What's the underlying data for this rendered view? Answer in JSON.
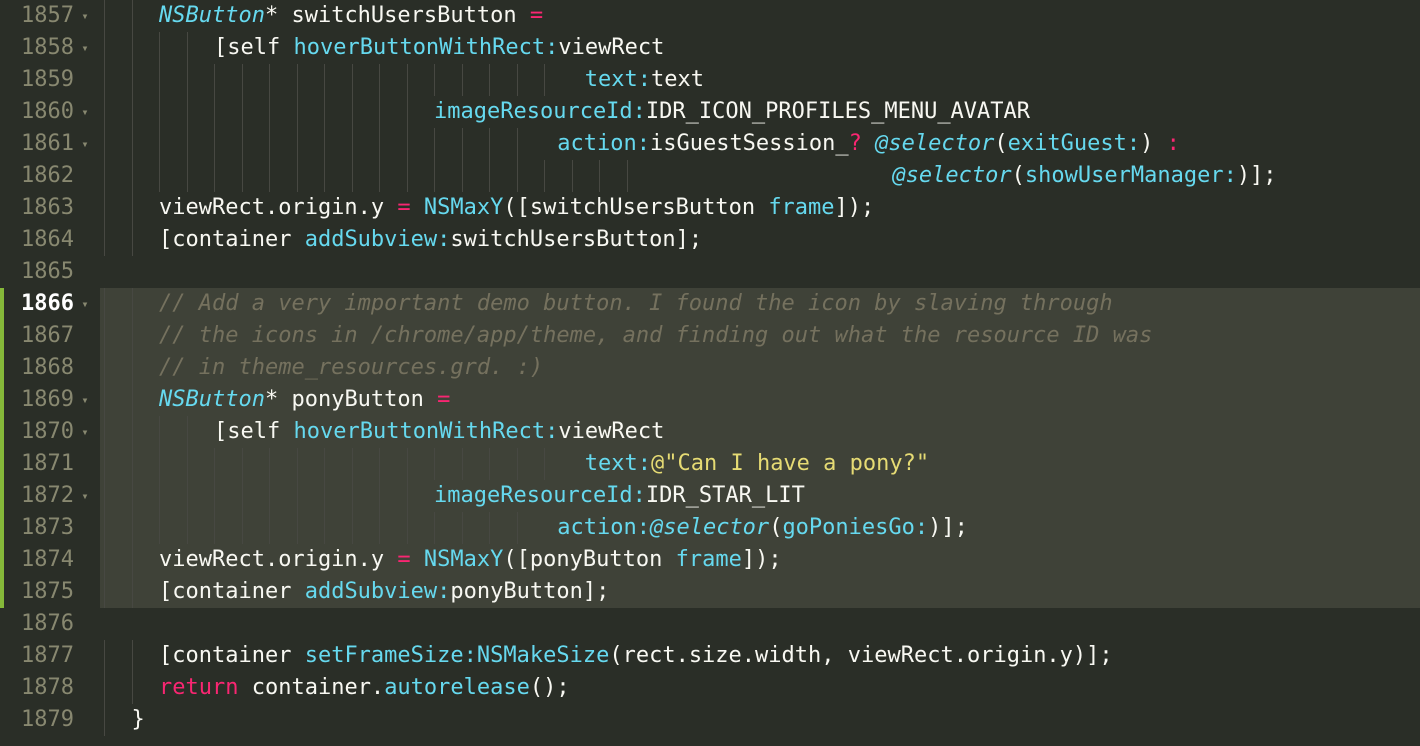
{
  "editor": {
    "visible_lines": [
      {
        "num": "1857",
        "fold": true,
        "marker": "",
        "hl": false,
        "tokens": [
          {
            "t": "    ",
            "c": "tok-default"
          },
          {
            "t": "NSButton",
            "c": "tok-type"
          },
          {
            "t": "* switchUsersButton ",
            "c": "tok-default"
          },
          {
            "t": "=",
            "c": "tok-op"
          }
        ]
      },
      {
        "num": "1858",
        "fold": true,
        "marker": "",
        "hl": false,
        "tokens": [
          {
            "t": "        [",
            "c": "tok-default"
          },
          {
            "t": "self",
            "c": "tok-default"
          },
          {
            "t": " ",
            "c": "tok-default"
          },
          {
            "t": "hoverButtonWithRect:",
            "c": "tok-msg"
          },
          {
            "t": "viewRect",
            "c": "tok-default"
          }
        ]
      },
      {
        "num": "1859",
        "fold": false,
        "marker": "",
        "hl": false,
        "tokens": [
          {
            "t": "                                   ",
            "c": "tok-default"
          },
          {
            "t": "text:",
            "c": "tok-msg"
          },
          {
            "t": "text",
            "c": "tok-default"
          }
        ]
      },
      {
        "num": "1860",
        "fold": true,
        "marker": "",
        "hl": false,
        "tokens": [
          {
            "t": "                        ",
            "c": "tok-default"
          },
          {
            "t": "imageResourceId:",
            "c": "tok-msg"
          },
          {
            "t": "IDR_ICON_PROFILES_MENU_AVATAR",
            "c": "tok-default"
          }
        ]
      },
      {
        "num": "1861",
        "fold": true,
        "marker": "",
        "hl": false,
        "tokens": [
          {
            "t": "                                 ",
            "c": "tok-default"
          },
          {
            "t": "action:",
            "c": "tok-msg"
          },
          {
            "t": "isGuestSession_",
            "c": "tok-default"
          },
          {
            "t": "?",
            "c": "tok-op"
          },
          {
            "t": " ",
            "c": "tok-default"
          },
          {
            "t": "@selector",
            "c": "tok-selector"
          },
          {
            "t": "(",
            "c": "tok-punct"
          },
          {
            "t": "exitGuest:",
            "c": "tok-msg"
          },
          {
            "t": ") ",
            "c": "tok-punct"
          },
          {
            "t": ":",
            "c": "tok-op"
          }
        ]
      },
      {
        "num": "1862",
        "fold": false,
        "marker": "",
        "hl": false,
        "tokens": [
          {
            "t": "                                                          ",
            "c": "tok-default"
          },
          {
            "t": "@selector",
            "c": "tok-selector"
          },
          {
            "t": "(",
            "c": "tok-punct"
          },
          {
            "t": "showUserManager:",
            "c": "tok-msg"
          },
          {
            "t": ")];",
            "c": "tok-punct"
          }
        ]
      },
      {
        "num": "1863",
        "fold": false,
        "marker": "",
        "hl": false,
        "tokens": [
          {
            "t": "    viewRect.origin.y ",
            "c": "tok-default"
          },
          {
            "t": "=",
            "c": "tok-op"
          },
          {
            "t": " ",
            "c": "tok-default"
          },
          {
            "t": "NSMaxY",
            "c": "tok-func"
          },
          {
            "t": "([switchUsersButton ",
            "c": "tok-default"
          },
          {
            "t": "frame",
            "c": "tok-msg"
          },
          {
            "t": "]);",
            "c": "tok-punct"
          }
        ]
      },
      {
        "num": "1864",
        "fold": false,
        "marker": "",
        "hl": false,
        "tokens": [
          {
            "t": "    [container ",
            "c": "tok-default"
          },
          {
            "t": "addSubview:",
            "c": "tok-msg"
          },
          {
            "t": "switchUsersButton];",
            "c": "tok-default"
          }
        ]
      },
      {
        "num": "1865",
        "fold": false,
        "marker": "",
        "hl": false,
        "tokens": [
          {
            "t": "",
            "c": "tok-default"
          }
        ]
      },
      {
        "num": "1866",
        "fold": true,
        "marker": "green",
        "hl": true,
        "current": true,
        "tokens": [
          {
            "t": "    ",
            "c": "tok-default"
          },
          {
            "t": "// Add a very important demo button. I found the icon by slaving through",
            "c": "tok-comment"
          }
        ]
      },
      {
        "num": "1867",
        "fold": false,
        "marker": "green",
        "hl": true,
        "tokens": [
          {
            "t": "    ",
            "c": "tok-default"
          },
          {
            "t": "// the icons in /chrome/app/theme, and finding out what the resource ID was",
            "c": "tok-comment"
          }
        ]
      },
      {
        "num": "1868",
        "fold": false,
        "marker": "green",
        "hl": true,
        "tokens": [
          {
            "t": "    ",
            "c": "tok-default"
          },
          {
            "t": "// in theme_resources.grd. :)",
            "c": "tok-comment"
          }
        ]
      },
      {
        "num": "1869",
        "fold": true,
        "marker": "green",
        "hl": true,
        "tokens": [
          {
            "t": "    ",
            "c": "tok-default"
          },
          {
            "t": "NSButton",
            "c": "tok-type"
          },
          {
            "t": "* ponyButton ",
            "c": "tok-default"
          },
          {
            "t": "=",
            "c": "tok-op"
          }
        ]
      },
      {
        "num": "1870",
        "fold": true,
        "marker": "green",
        "hl": true,
        "tokens": [
          {
            "t": "        [",
            "c": "tok-default"
          },
          {
            "t": "self",
            "c": "tok-default"
          },
          {
            "t": " ",
            "c": "tok-default"
          },
          {
            "t": "hoverButtonWithRect:",
            "c": "tok-msg"
          },
          {
            "t": "viewRect",
            "c": "tok-default"
          }
        ]
      },
      {
        "num": "1871",
        "fold": false,
        "marker": "green",
        "hl": true,
        "tokens": [
          {
            "t": "                                   ",
            "c": "tok-default"
          },
          {
            "t": "text:",
            "c": "tok-msg"
          },
          {
            "t": "@\"Can I have a pony?\"",
            "c": "tok-string"
          }
        ]
      },
      {
        "num": "1872",
        "fold": true,
        "marker": "green",
        "hl": true,
        "tokens": [
          {
            "t": "                        ",
            "c": "tok-default"
          },
          {
            "t": "imageResourceId:",
            "c": "tok-msg"
          },
          {
            "t": "IDR_STAR_LIT",
            "c": "tok-default"
          }
        ]
      },
      {
        "num": "1873",
        "fold": false,
        "marker": "green",
        "hl": true,
        "tokens": [
          {
            "t": "                                 ",
            "c": "tok-default"
          },
          {
            "t": "action:",
            "c": "tok-msg"
          },
          {
            "t": "@selector",
            "c": "tok-selector"
          },
          {
            "t": "(",
            "c": "tok-punct"
          },
          {
            "t": "goPoniesGo:",
            "c": "tok-msg"
          },
          {
            "t": ")];",
            "c": "tok-punct"
          }
        ]
      },
      {
        "num": "1874",
        "fold": false,
        "marker": "green",
        "hl": true,
        "tokens": [
          {
            "t": "    viewRect.origin.y ",
            "c": "tok-default"
          },
          {
            "t": "=",
            "c": "tok-op"
          },
          {
            "t": " ",
            "c": "tok-default"
          },
          {
            "t": "NSMaxY",
            "c": "tok-func"
          },
          {
            "t": "([ponyButton ",
            "c": "tok-default"
          },
          {
            "t": "frame",
            "c": "tok-msg"
          },
          {
            "t": "]);",
            "c": "tok-punct"
          }
        ]
      },
      {
        "num": "1875",
        "fold": false,
        "marker": "green",
        "hl": true,
        "tokens": [
          {
            "t": "    [container ",
            "c": "tok-default"
          },
          {
            "t": "addSubview:",
            "c": "tok-msg"
          },
          {
            "t": "ponyButton];",
            "c": "tok-default"
          }
        ]
      },
      {
        "num": "1876",
        "fold": false,
        "marker": "",
        "hl": false,
        "tokens": [
          {
            "t": "",
            "c": "tok-default"
          }
        ]
      },
      {
        "num": "1877",
        "fold": false,
        "marker": "",
        "hl": false,
        "tokens": [
          {
            "t": "    [container ",
            "c": "tok-default"
          },
          {
            "t": "setFrameSize:",
            "c": "tok-msg"
          },
          {
            "t": "NSMakeSize",
            "c": "tok-func"
          },
          {
            "t": "(rect.size.width, viewRect.origin.y)];",
            "c": "tok-default"
          }
        ]
      },
      {
        "num": "1878",
        "fold": false,
        "marker": "",
        "hl": false,
        "tokens": [
          {
            "t": "    ",
            "c": "tok-default"
          },
          {
            "t": "return",
            "c": "tok-keyword"
          },
          {
            "t": " container.",
            "c": "tok-default"
          },
          {
            "t": "autorelease",
            "c": "tok-func"
          },
          {
            "t": "();",
            "c": "tok-default"
          }
        ]
      },
      {
        "num": "1879",
        "fold": false,
        "marker": "",
        "hl": false,
        "tokens": [
          {
            "t": "  }",
            "c": "tok-default"
          }
        ]
      }
    ]
  }
}
